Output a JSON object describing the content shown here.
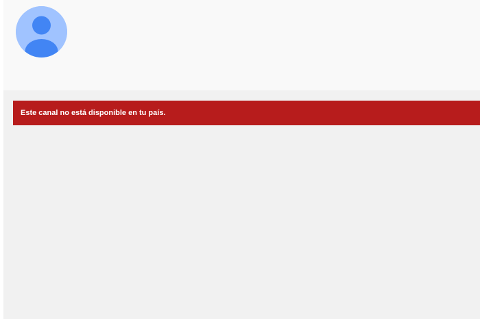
{
  "header": {
    "avatar_icon": "default-user-avatar-icon"
  },
  "alert": {
    "message": "Este canal no está disponible en tu país."
  },
  "colors": {
    "header_bg": "#f9f9f9",
    "content_bg": "#f1f1f1",
    "alert_bg": "#b71c1c",
    "alert_text": "#ffffff",
    "avatar_bg": "#a0c3ff",
    "avatar_figure": "#4285f4"
  }
}
